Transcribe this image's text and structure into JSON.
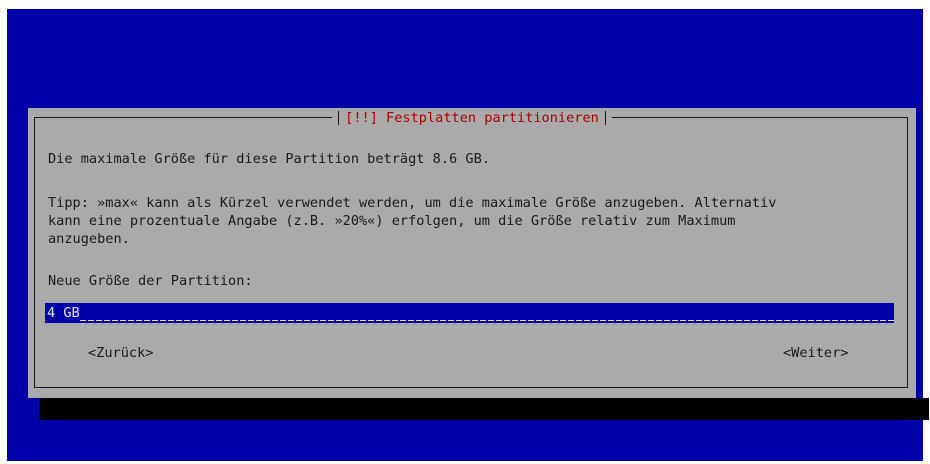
{
  "dialog": {
    "title": "[!!] Festplatten partitionieren",
    "max_size_text": "Die maximale Größe für diese Partition beträgt 8.6 GB.",
    "tip_lines": [
      "Tipp: »max« kann als Kürzel verwendet werden, um die maximale Größe anzugeben. Alternativ",
      "kann eine prozentuale Angabe (z.B. »20%«) erfolgen, um die Größe relativ zum Maximum",
      "anzugeben."
    ],
    "field_label": "Neue Größe der Partition:",
    "field_value": "4 GB",
    "back_label": "<Zurück>",
    "next_label": "<Weiter>"
  },
  "colors": {
    "screen_background": "#0000a8",
    "dialog_background": "#aaaaaa",
    "title_text": "#a80000",
    "input_background": "#0000a8"
  }
}
